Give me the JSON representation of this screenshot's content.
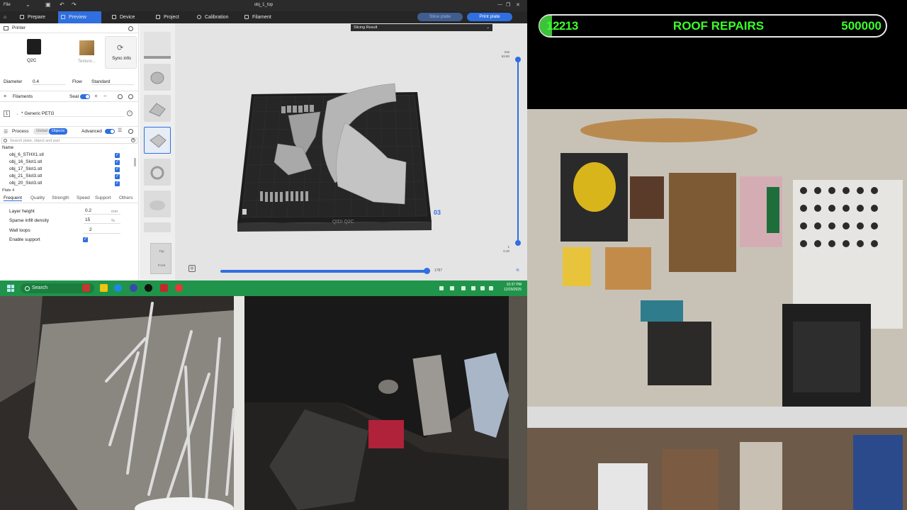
{
  "window": {
    "file_menu": "File",
    "title": "obj_1_top"
  },
  "menubar": {
    "tabs": [
      {
        "label": "Prepare",
        "active": false
      },
      {
        "label": "Preview",
        "active": true
      },
      {
        "label": "Device",
        "active": false
      },
      {
        "label": "Project",
        "active": false
      },
      {
        "label": "Calibration",
        "active": false
      },
      {
        "label": "Filament",
        "active": false
      }
    ],
    "slice_plate": "Slice plate",
    "print_plate": "Print plate"
  },
  "printer_panel": {
    "header": "Printer",
    "printer_name": "Q2C",
    "texture_label": "Texture...",
    "sync_label": "Sync info",
    "diameter_label": "Diameter",
    "diameter_value": "0.4",
    "flow_label": "Flow",
    "flow_value": "Standard"
  },
  "filaments": {
    "header": "Filaments",
    "seal_label": "Seal",
    "slot_number": "1",
    "filament_name": "* Generic PETG"
  },
  "process": {
    "header": "Process",
    "global_label": "Global",
    "objects_label": "Objects",
    "advanced_label": "Advanced",
    "search_placeholder": "Search plate, object and part",
    "name_header": "Name",
    "objects": [
      "obj_6_STHX1.stl",
      "obj_16_Slot1.stl",
      "obj_17_Slot1.stl",
      "obj_21_Slot3.stl",
      "obj_20_Slot3.stl"
    ],
    "plate_label": "Plate 4",
    "tabs": [
      "Frequent",
      "Quality",
      "Strength",
      "Speed",
      "Support",
      "Others"
    ],
    "fields": {
      "layer_height_label": "Layer height",
      "layer_height_value": "0.2",
      "layer_height_unit": "mm",
      "sparse_infill_label": "Sparse infill density",
      "sparse_infill_value": "15",
      "sparse_infill_unit": "%",
      "wall_loops_label": "Wall loops",
      "wall_loops_value": "2",
      "enable_support_label": "Enable support"
    }
  },
  "viewport": {
    "slicing_result": "Slicing Result",
    "layer_top": "319\n63.80",
    "layer_bottom": "1\n0.20",
    "plate_number": "03",
    "progress_value": "1787",
    "progress_fraction": 0.99,
    "bed_brand": "QIDI Q2C",
    "viewcube_top": "Top",
    "viewcube_front": "Front"
  },
  "taskbar": {
    "search_label": "Search",
    "time": "10:37 PM",
    "date": "12/29/2025"
  },
  "scoreboard": {
    "current": "12213",
    "title": "ROOF REPAIRS",
    "goal": "500000",
    "progress_fraction": 0.024,
    "color": "#3cff2a"
  },
  "colors": {
    "accent": "#2f6fe0",
    "taskbar": "#20944a"
  }
}
